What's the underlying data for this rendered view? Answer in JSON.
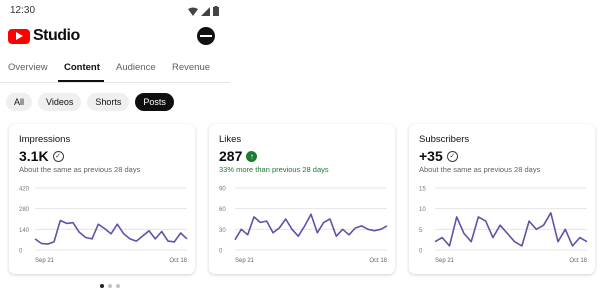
{
  "status_bar": {
    "time": "12:30"
  },
  "app": {
    "name": "Studio"
  },
  "tabs": [
    {
      "label": "Overview"
    },
    {
      "label": "Content"
    },
    {
      "label": "Audience"
    },
    {
      "label": "Revenue"
    }
  ],
  "active_tab": "Content",
  "chips": [
    {
      "label": "All"
    },
    {
      "label": "Videos"
    },
    {
      "label": "Shorts"
    },
    {
      "label": "Posts"
    }
  ],
  "active_chip": "Posts",
  "cards": [
    {
      "title": "Impressions",
      "value": "3.1K",
      "subtitle": "About the same as previous 28 days"
    },
    {
      "title": "Likes",
      "value": "287",
      "subtitle": "33% more than previous 28 days"
    },
    {
      "title": "Subscribers",
      "value": "+35",
      "subtitle": "About the same as previous 28 days"
    }
  ],
  "colors": {
    "brand_red": "#ff0000",
    "line": "#5b55a8",
    "positive_green": "#1e7b34"
  },
  "chart_data": [
    {
      "type": "line",
      "ylim": [
        0,
        420
      ],
      "yticks": [
        "420",
        "280",
        "140",
        "0"
      ],
      "x_labels": [
        "Sep 21",
        "Oct 18"
      ],
      "grid": true,
      "values": [
        75,
        45,
        40,
        55,
        200,
        180,
        185,
        120,
        85,
        75,
        175,
        145,
        110,
        175,
        110,
        75,
        60,
        95,
        130,
        75,
        125,
        60,
        55,
        115,
        75
      ]
    },
    {
      "type": "line",
      "ylim": [
        0,
        90
      ],
      "yticks": [
        "90",
        "60",
        "30",
        "0"
      ],
      "x_labels": [
        "Sep 21",
        "Oct 18"
      ],
      "grid": true,
      "values": [
        15,
        30,
        22,
        48,
        40,
        42,
        25,
        32,
        45,
        30,
        20,
        35,
        52,
        25,
        40,
        45,
        20,
        30,
        22,
        32,
        35,
        30,
        28,
        30,
        35
      ]
    },
    {
      "type": "line",
      "ylim": [
        0,
        15
      ],
      "yticks": [
        "15",
        "10",
        "5",
        "0"
      ],
      "x_labels": [
        "Sep 21",
        "Oct 18"
      ],
      "grid": true,
      "values": [
        2,
        3,
        1,
        8,
        4,
        2,
        8,
        7,
        3,
        6,
        4,
        2,
        1,
        7,
        5,
        6,
        9,
        2,
        5,
        1,
        3,
        2
      ]
    }
  ],
  "pager": {
    "count": 3,
    "active": 0
  }
}
